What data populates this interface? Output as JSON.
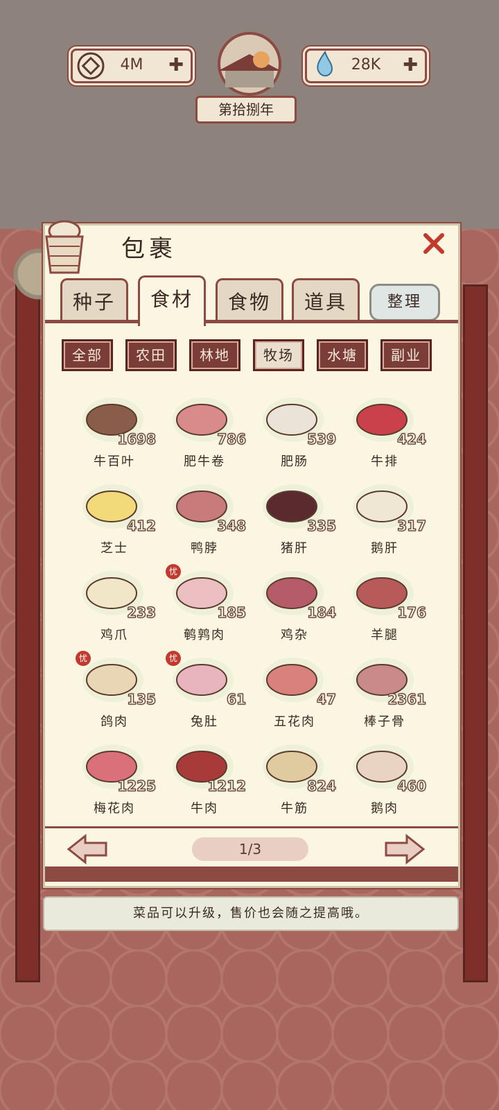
{
  "resources": {
    "coins": "4M",
    "water": "28K",
    "plus": "✚"
  },
  "year_label": "第拾捌年",
  "bag": {
    "title": "包裹",
    "tabs": [
      "种子",
      "食材",
      "食物",
      "道具"
    ],
    "active_tab": "食材",
    "sort_label": "整理",
    "filters": [
      "全部",
      "农田",
      "林地",
      "牧场",
      "水塘",
      "副业"
    ],
    "active_filter": "牧场",
    "items": [
      {
        "name": "牛百叶",
        "count": "1698",
        "icon": "tripe-icon"
      },
      {
        "name": "肥牛卷",
        "count": "786",
        "icon": "beef-roll-icon"
      },
      {
        "name": "肥肠",
        "count": "539",
        "icon": "intestine-icon"
      },
      {
        "name": "牛排",
        "count": "424",
        "icon": "steak-icon"
      },
      {
        "name": "芝士",
        "count": "412",
        "icon": "cheese-icon"
      },
      {
        "name": "鸭脖",
        "count": "348",
        "icon": "duck-neck-icon"
      },
      {
        "name": "猪肝",
        "count": "335",
        "icon": "pork-liver-icon"
      },
      {
        "name": "鹅肝",
        "count": "317",
        "icon": "foie-gras-icon"
      },
      {
        "name": "鸡爪",
        "count": "233",
        "icon": "chicken-feet-icon"
      },
      {
        "name": "鹌鹑肉",
        "count": "185",
        "icon": "quail-icon",
        "badge": true
      },
      {
        "name": "鸡杂",
        "count": "184",
        "icon": "giblets-icon"
      },
      {
        "name": "羊腿",
        "count": "176",
        "icon": "lamb-leg-icon"
      },
      {
        "name": "鸽肉",
        "count": "135",
        "icon": "pigeon-icon",
        "badge": true
      },
      {
        "name": "兔肚",
        "count": "61",
        "icon": "rabbit-tripe-icon",
        "badge": true
      },
      {
        "name": "五花肉",
        "count": "47",
        "icon": "pork-belly-icon"
      },
      {
        "name": "棒子骨",
        "count": "2361",
        "icon": "bone-icon"
      },
      {
        "name": "梅花肉",
        "count": "1225",
        "icon": "pork-shoulder-icon"
      },
      {
        "name": "牛肉",
        "count": "1212",
        "icon": "beef-icon"
      },
      {
        "name": "牛筋",
        "count": "824",
        "icon": "tendon-icon"
      },
      {
        "name": "鹅肉",
        "count": "460",
        "icon": "goose-meat-icon"
      }
    ],
    "badge_glyph": "忧",
    "page_indicator": "1/3"
  },
  "tip": "菜品可以升级，售价也会随之提高哦。",
  "colors": {
    "accent": "#8c4a42",
    "panel": "#fbf6e2",
    "close": "#c23a2e"
  }
}
